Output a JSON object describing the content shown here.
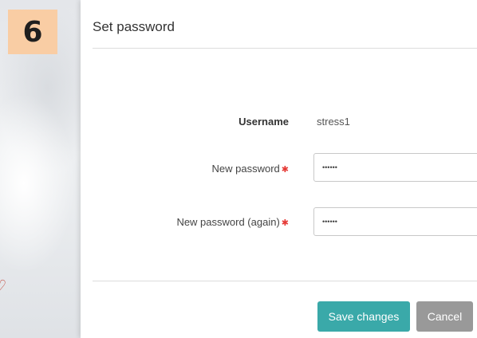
{
  "step_badge": "6",
  "dialog": {
    "title": "Set password",
    "username_label": "Username",
    "username_value": "stress1",
    "new_password_label": "New password",
    "new_password_value": "••••••",
    "new_password_again_label": "New password (again)",
    "new_password_again_value": "••••••",
    "required_marker": "✱",
    "save_label": "Save changes",
    "cancel_label": "Cancel"
  },
  "colors": {
    "badge": "#f9cda4",
    "save_button": "#3aa9a9",
    "cancel_button": "#999999",
    "required": "#e53935"
  }
}
